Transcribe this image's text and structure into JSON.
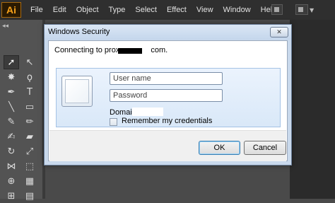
{
  "app": {
    "logo_text": "Ai",
    "menu": [
      "File",
      "Edit",
      "Object",
      "Type",
      "Select",
      "Effect",
      "View",
      "Window",
      "Help"
    ]
  },
  "toolbar": {
    "panel_collapse": "◂◂"
  },
  "dialog": {
    "title": "Windows Security",
    "close_glyph": "✕",
    "connecting_prefix": "Connecting to prox",
    "connecting_suffix": "com.",
    "username_placeholder": "User name",
    "password_placeholder": "Password",
    "domain_label": "Domai",
    "remember_label": "Remember my credentials",
    "remember_checked": false,
    "ok_label": "OK",
    "cancel_label": "Cancel"
  },
  "colors": {
    "illustrator_accent": "#f7a21b",
    "dialog_frame": "#c9d9ec"
  }
}
